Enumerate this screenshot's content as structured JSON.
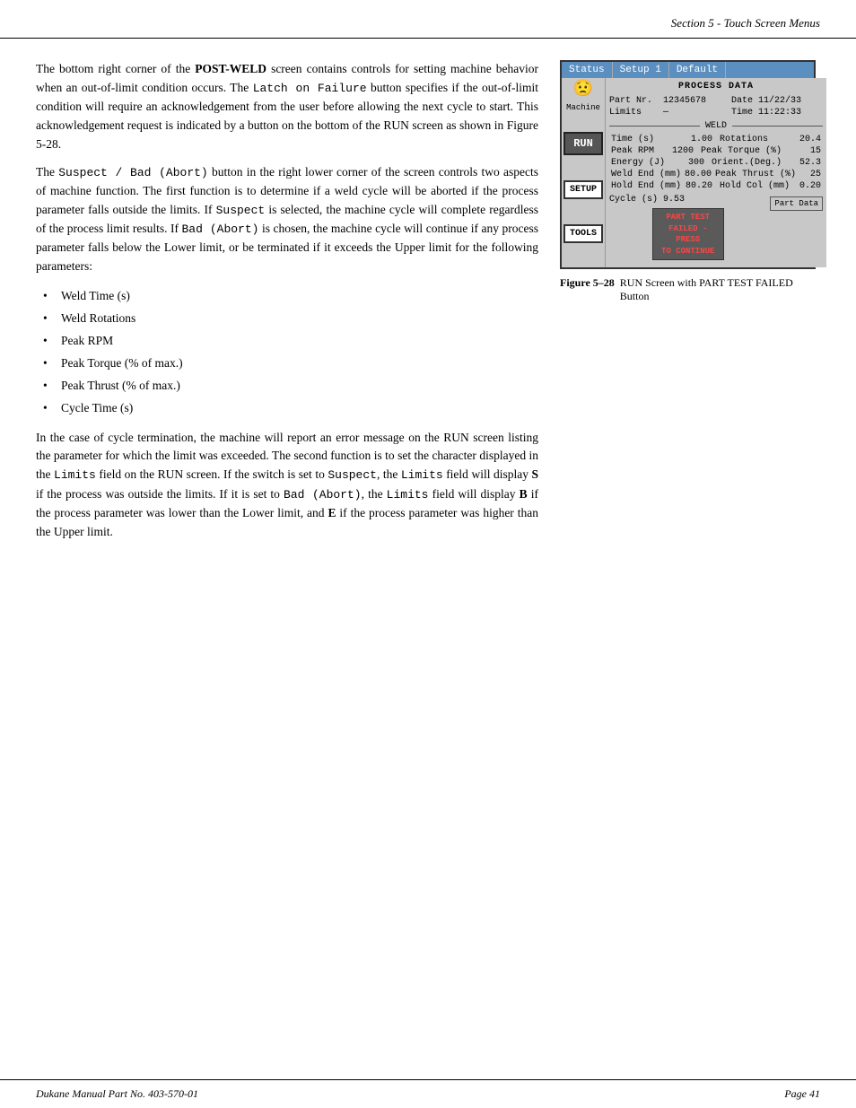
{
  "header": {
    "text": "Section 5 - Touch Screen Menus"
  },
  "body": {
    "paragraphs": [
      "The bottom right corner of the POST-WELD screen contains controls for setting machine behavior when an out-of-limit condition occurs. The Latch on Failure button specifies if the out-of-limit condition will require an acknowledgement from the user before allowing the next cycle to start. This acknowledgement request is indicated by a button on the bottom of the RUN screen as shown in Figure 5-28.",
      "The Suspect / Bad (Abort) button in the right lower corner of the screen controls two aspects of machine function. The first function is to determine if a weld cycle will be aborted if the process parameter falls outside the limits. If Suspect is selected, the machine cycle will complete regardless of the process limit results. If Bad (Abort) is chosen, the machine cycle will continue if any process parameter falls below the Lower limit, or be terminated if it exceeds the Upper limit for the following parameters:"
    ],
    "bullets": [
      "Weld Time (s)",
      "Weld Rotations",
      "Peak RPM",
      "Peak Torque (% of max.)",
      "Peak Thrust (% of max.)",
      "Cycle Time (s)"
    ],
    "paragraphs2": [
      "In the case of cycle termination, the machine will report an error message on the RUN screen listing the parameter for which the limit was exceeded. The second function is to set the character displayed in the Limits field on the RUN screen.  If the switch is set to Suspect, the Limits field will display S if the process was outside the limits. If it is set to Bad (Abort), the Limits field will display B if the process parameter was lower than the Lower limit, and E if the process parameter was higher than the Upper limit."
    ]
  },
  "figure": {
    "screen": {
      "tabs": [
        "Status",
        "Setup 1",
        "Default"
      ],
      "sidebar": {
        "machine_label": "Machine",
        "run_label": "RUN",
        "setup_label": "SETUP",
        "tools_label": "TOOLS"
      },
      "process_data_title": "PROCESS DATA",
      "part_nr_label": "Part Nr.",
      "part_nr_value": "12345678",
      "date_label": "Date",
      "date_value": "11/22/33",
      "limits_label": "Limits",
      "limits_value": "—",
      "time_label": "Time",
      "time_value": "11:22:33",
      "weld_label": "WELD",
      "rows": [
        {
          "label1": "Time (s)",
          "val1": "1.00",
          "label2": "Rotations",
          "val2": "20.4"
        },
        {
          "label1": "Peak RPM",
          "val1": "1200",
          "label2": "Peak Torque (%)",
          "val2": "15"
        },
        {
          "label1": "Energy (J)",
          "val1": "300",
          "label2": "Orient.(Deg.)",
          "val2": "52.3"
        },
        {
          "label1": "Weld End (mm)",
          "val1": "80.00",
          "label2": "Peak Thrust (%)",
          "val2": "25"
        },
        {
          "label1": "Hold End (mm)",
          "val1": "80.20",
          "label2": "Hold Col (mm)",
          "val2": "0.20"
        }
      ],
      "cycle_label": "Cycle (s)",
      "cycle_value": "9.53",
      "part_test_line1": "PART TEST",
      "part_test_line2": "FAILED - PRESS",
      "part_test_line3": "TO CONTINUE",
      "part_data_label": "Part Data"
    },
    "caption_label": "Figure 5–28",
    "caption_text": "RUN Screen with PART TEST FAILED Button"
  },
  "footer": {
    "left": "Dukane Manual Part No. 403-570-01",
    "right": "Page   41"
  }
}
